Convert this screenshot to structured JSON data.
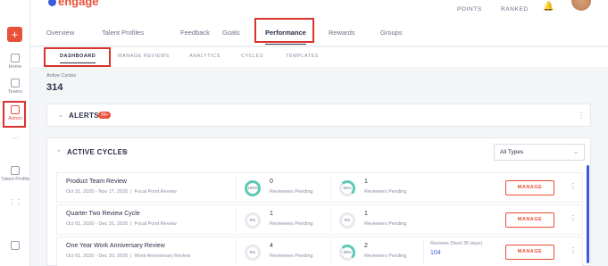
{
  "app": {
    "logo_text": "engage",
    "points_label": "POINTS",
    "ranked_label": "RANKED",
    "bell_icon": "bell-icon"
  },
  "rail": {
    "add_symbol": "+",
    "items": [
      {
        "label": "Home",
        "icon": "home-icon"
      },
      {
        "label": "Teams",
        "icon": "teams-icon"
      },
      {
        "label": "Admin",
        "icon": "admin-icon",
        "active": true
      },
      {
        "label": "···",
        "icon": "more-icon"
      },
      {
        "label": "Talent Profile",
        "icon": "talent-profile-icon"
      },
      {
        "label": "⋮⋮",
        "icon": "grid-icon"
      },
      {
        "label": "",
        "icon": "download-icon"
      }
    ]
  },
  "tabs": [
    "Overview",
    "Talent Profiles",
    "Feedback",
    "Goals",
    "Performance",
    "Rewards",
    "Groups"
  ],
  "active_tab": "Performance",
  "subtabs": [
    "DASHBOARD",
    "MANAGE REVIEWS",
    "ANALYTICS",
    "CYCLES",
    "TEMPLATES"
  ],
  "active_subtab": "DASHBOARD",
  "counter": {
    "label": "Active Cycles",
    "value": "314"
  },
  "alerts": {
    "title": "ALERTS",
    "badge": "99+"
  },
  "cycles": {
    "title": "ACTIVE CYCLES",
    "filter": "All Types",
    "rows": [
      {
        "name": "Product Team Review",
        "dates": "Oct 31, 2020 - Nov 17, 2020",
        "type": "Focal Point Review",
        "reviewees_pct": "100%",
        "reviewees_count": "0",
        "reviewees_label": "Reviewees Pending",
        "reviewers_pct": "50%",
        "reviewers_count": "1",
        "reviewers_label": "Reviewers Pending",
        "action": "MANAGE"
      },
      {
        "name": "Quarter Two Review Cycle",
        "dates": "Oct 01, 2020 - Dec 31, 2020",
        "type": "Focal Point Review",
        "reviewees_pct": "0%",
        "reviewees_count": "1",
        "reviewees_label": "Reviewees Pending",
        "reviewers_pct": "0%",
        "reviewers_count": "1",
        "reviewers_label": "Reviewers Pending",
        "action": "MANAGE"
      },
      {
        "name": "One Year Work Anniversary Review",
        "dates": "Oct 01, 2020 - Dec 30, 2020",
        "type": "Work Anniversary Review",
        "reviewees_pct": "0%",
        "reviewees_count": "4",
        "reviewees_label": "Reviewees Pending",
        "reviewers_pct": "50%",
        "reviewers_count": "2",
        "reviewers_label": "Reviewers Pending",
        "extra_label": "Reviews (Next 30 days)",
        "extra_value": "104",
        "action": "MANAGE"
      }
    ]
  }
}
